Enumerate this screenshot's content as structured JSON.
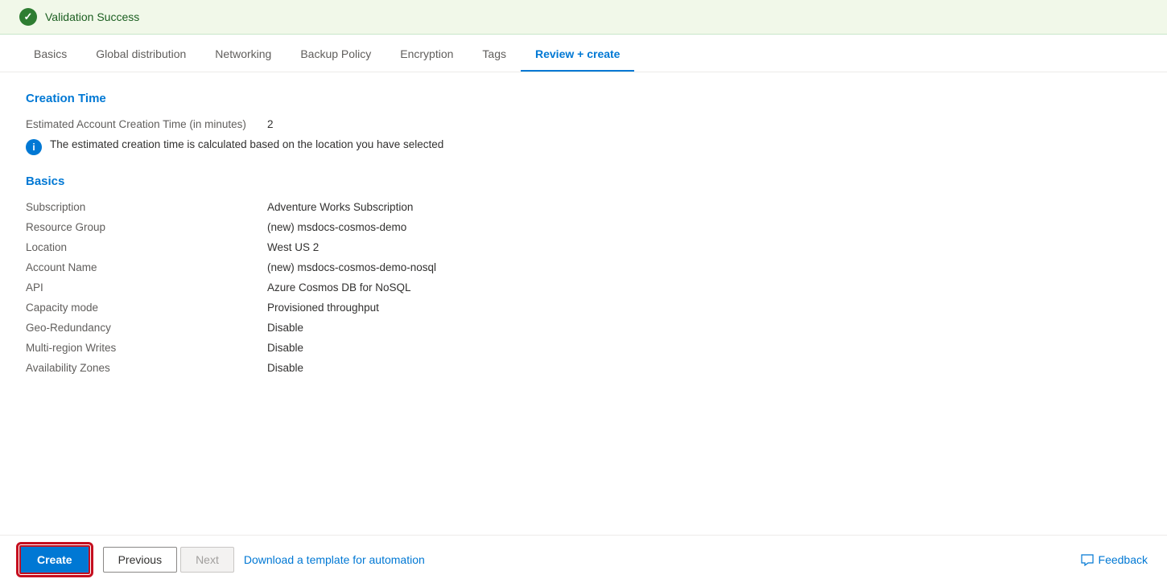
{
  "validation": {
    "text": "Validation Success"
  },
  "tabs": [
    {
      "id": "basics",
      "label": "Basics",
      "active": false
    },
    {
      "id": "global-distribution",
      "label": "Global distribution",
      "active": false
    },
    {
      "id": "networking",
      "label": "Networking",
      "active": false
    },
    {
      "id": "backup-policy",
      "label": "Backup Policy",
      "active": false
    },
    {
      "id": "encryption",
      "label": "Encryption",
      "active": false
    },
    {
      "id": "tags",
      "label": "Tags",
      "active": false
    },
    {
      "id": "review-create",
      "label": "Review + create",
      "active": true
    }
  ],
  "creation_time": {
    "heading": "Creation Time",
    "label": "Estimated Account Creation Time (in minutes)",
    "value": "2",
    "note": "The estimated creation time is calculated based on the location you have selected"
  },
  "basics": {
    "heading": "Basics",
    "rows": [
      {
        "label": "Subscription",
        "value": "Adventure Works Subscription"
      },
      {
        "label": "Resource Group",
        "value": "(new) msdocs-cosmos-demo"
      },
      {
        "label": "Location",
        "value": "West US 2"
      },
      {
        "label": "Account Name",
        "value": "(new) msdocs-cosmos-demo-nosql"
      },
      {
        "label": "API",
        "value": "Azure Cosmos DB for NoSQL"
      },
      {
        "label": "Capacity mode",
        "value": "Provisioned throughput"
      },
      {
        "label": "Geo-Redundancy",
        "value": "Disable"
      },
      {
        "label": "Multi-region Writes",
        "value": "Disable"
      },
      {
        "label": "Availability Zones",
        "value": "Disable"
      }
    ]
  },
  "footer": {
    "create_label": "Create",
    "previous_label": "Previous",
    "next_label": "Next",
    "automation_label": "Download a template for automation",
    "feedback_label": "Feedback"
  }
}
